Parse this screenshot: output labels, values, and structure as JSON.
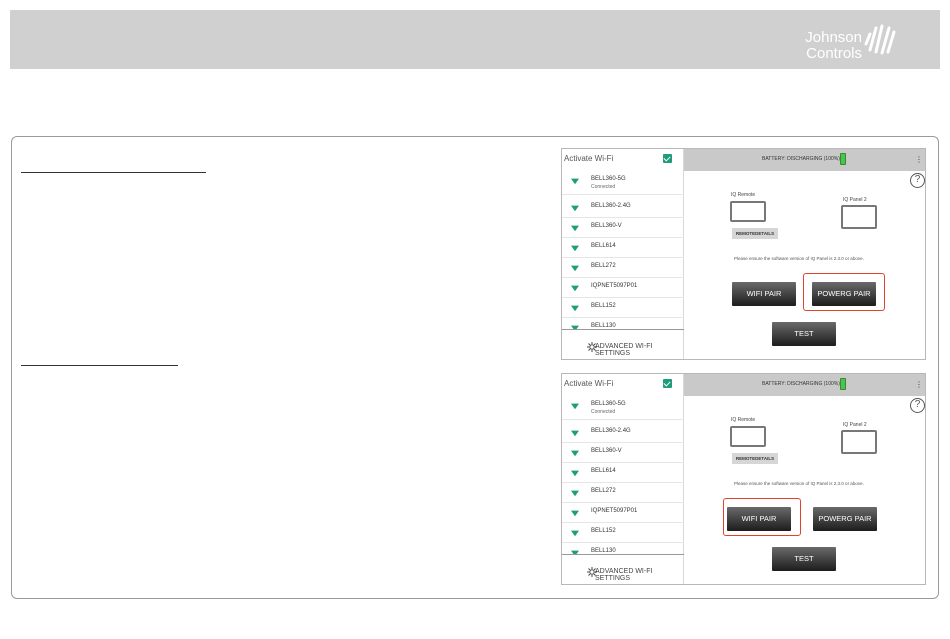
{
  "header": {
    "logo_line1": "Johnson",
    "logo_line2": "Controls",
    "accent": "#d0d0d0"
  },
  "panels": [
    {
      "wifi": {
        "title": "Activate Wi-Fi",
        "networks": [
          {
            "name": "BELL360-5G",
            "sub": "Connected"
          },
          {
            "name": "BELL360-2.4G",
            "sub": ""
          },
          {
            "name": "BELL360-V",
            "sub": ""
          },
          {
            "name": "BELL614",
            "sub": ""
          },
          {
            "name": "BELL272",
            "sub": ""
          },
          {
            "name": "IQPNET5097P01",
            "sub": ""
          },
          {
            "name": "BELL152",
            "sub": ""
          },
          {
            "name": "BELL130",
            "sub": ""
          }
        ],
        "advanced": "ADVANCED WI-FI SETTINGS"
      },
      "status": "BATTERY: DISCHARGING (100%)",
      "kebab": "⋮",
      "help": "?",
      "iq_remote": "IQ Remote",
      "iq_panel": "IQ Panel 2",
      "remote_details": "REMOTEDETAILS",
      "ensure": "Please ensure the software version of IQ Panel is 2.3.0 or above.",
      "wifi_pair": "WIFI PAIR",
      "powerg_pair": "POWERG PAIR",
      "test": "TEST",
      "highlighted": "powerg_pair"
    },
    {
      "wifi": {
        "title": "Activate Wi-Fi",
        "networks": [
          {
            "name": "BELL360-5G",
            "sub": "Connected"
          },
          {
            "name": "BELL360-2.4G",
            "sub": ""
          },
          {
            "name": "BELL360-V",
            "sub": ""
          },
          {
            "name": "BELL614",
            "sub": ""
          },
          {
            "name": "BELL272",
            "sub": ""
          },
          {
            "name": "IQPNET5097P01",
            "sub": ""
          },
          {
            "name": "BELL152",
            "sub": ""
          },
          {
            "name": "BELL130",
            "sub": ""
          }
        ],
        "advanced": "ADVANCED WI-FI SETTINGS"
      },
      "status": "BATTERY: DISCHARGING (100%)",
      "kebab": "⋮",
      "help": "?",
      "iq_remote": "IQ Remote",
      "iq_panel": "IQ Panel 2",
      "remote_details": "REMOTEDETAILS",
      "ensure": "Please ensure the software version of IQ Panel is 2.3.0 or above.",
      "wifi_pair": "WIFI PAIR",
      "powerg_pair": "POWERG PAIR",
      "test": "TEST",
      "highlighted": "wifi_pair"
    }
  ],
  "colors": {
    "checkbox": "#1f9d7a",
    "battery": "#4ec24e",
    "highlight": "#e0432c"
  }
}
